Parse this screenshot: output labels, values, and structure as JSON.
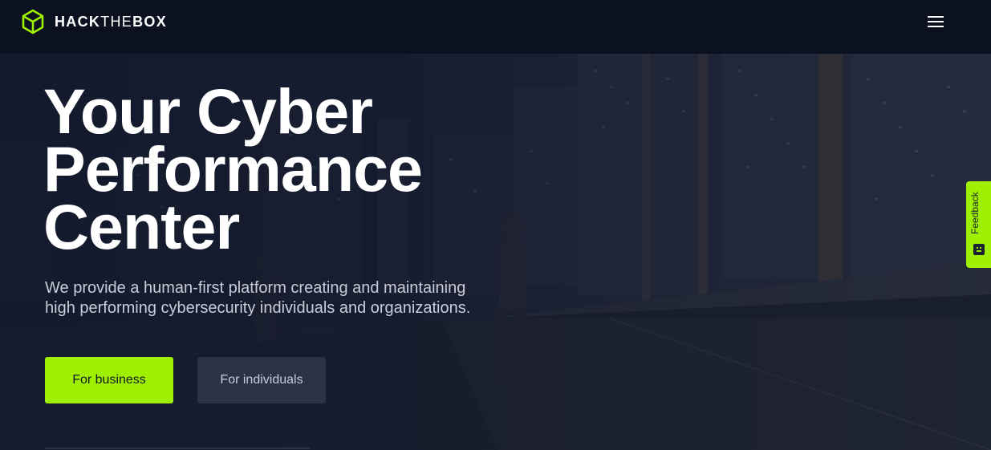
{
  "header": {
    "brand": {
      "part1": "HACK",
      "part2": "THE",
      "part3": "BOX",
      "logo_icon": "cube-icon",
      "accent_color": "#9fef00"
    },
    "menu_icon": "hamburger-menu-icon"
  },
  "hero": {
    "headline": [
      "Your Cyber",
      "Performance",
      "Center"
    ],
    "subtext": [
      "We provide a human-first platform creating and maintaining",
      "high performing cybersecurity individuals and organizations."
    ],
    "buttons": {
      "business": "For business",
      "individuals": "For individuals"
    }
  },
  "feedback_tab": {
    "label": "Feedback",
    "icon": "smiley-face-icon"
  },
  "colors": {
    "primary_green": "#9fef00",
    "nav_bg": "#0b111e",
    "secondary_button": "#2a3346"
  }
}
